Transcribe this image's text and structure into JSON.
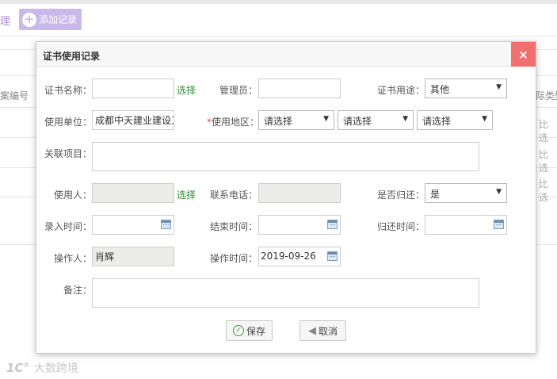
{
  "background": {
    "manage_text": "理",
    "add_button": "添加记录",
    "col_left": "案编号",
    "col_right": "际类型",
    "cells_right": [
      "比选",
      "比选",
      "比选"
    ],
    "watermark": "大数跨境"
  },
  "modal": {
    "title": "证书使用记录",
    "close_icon": "×",
    "cert_name": {
      "label": "证书名称：",
      "value": "",
      "select_link": "选择"
    },
    "admin": {
      "label": "管理员：",
      "value": ""
    },
    "purpose": {
      "label": "证书用途：",
      "value": "其他"
    },
    "unit": {
      "label": "使用单位：",
      "value": "成都中天建业建设工"
    },
    "region": {
      "required_mark": "*",
      "label": "使用地区：",
      "province": "请选择",
      "city": "请选择",
      "district": "请选择"
    },
    "project": {
      "label": "关联项目："
    },
    "user": {
      "label": "使用人：",
      "value": "",
      "select_link": "选择"
    },
    "phone": {
      "label": "联系电话：",
      "value": ""
    },
    "returned": {
      "label": "是否归还：",
      "value": "是"
    },
    "entry_time": {
      "label": "录入时间：",
      "value": ""
    },
    "end_time": {
      "label": "结束时间：",
      "value": ""
    },
    "return_time": {
      "label": "归还时间：",
      "value": ""
    },
    "operator": {
      "label": "操作人：",
      "value": "肖辉"
    },
    "operate_time": {
      "label": "操作时间：",
      "value": "2019-09-26"
    },
    "remark": {
      "label": "备注："
    },
    "save_label": "保存",
    "cancel_label": "取消"
  }
}
